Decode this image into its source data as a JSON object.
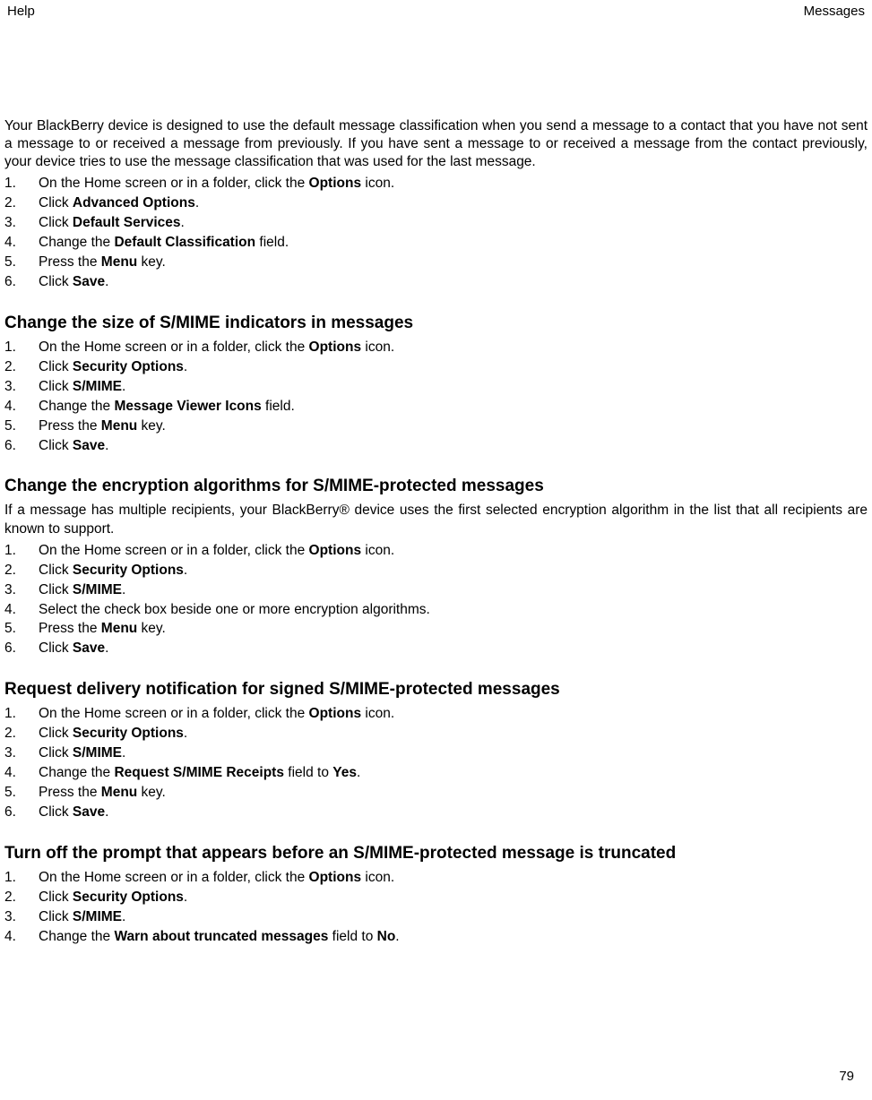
{
  "header": {
    "left": "Help",
    "right": "Messages"
  },
  "pageNumber": "79",
  "intro": "Your BlackBerry device is designed to use the default message classification when you send a message to a contact that you have not sent a message to or received a message from previously. If you have sent a message to or received a message from the contact previously, your device tries to use the message classification that was used for the last message.",
  "sec0": {
    "s1a": "On the Home screen or in a folder, click the ",
    "s1b": "Options",
    "s1c": " icon.",
    "s2a": "Click ",
    "s2b": "Advanced Options",
    "s2c": ".",
    "s3a": "Click ",
    "s3b": "Default Services",
    "s3c": ".",
    "s4a": "Change the ",
    "s4b": "Default Classification",
    "s4c": " field.",
    "s5a": "Press the ",
    "s5b": "Menu",
    "s5c": " key.",
    "s6a": "Click ",
    "s6b": "Save",
    "s6c": "."
  },
  "sec1": {
    "title": "Change the size of S/MIME indicators in messages",
    "s1a": "On the Home screen or in a folder, click the ",
    "s1b": "Options",
    "s1c": " icon.",
    "s2a": "Click ",
    "s2b": "Security Options",
    "s2c": ".",
    "s3a": "Click ",
    "s3b": "S/MIME",
    "s3c": ".",
    "s4a": "Change the ",
    "s4b": "Message Viewer Icons",
    "s4c": " field.",
    "s5a": "Press the ",
    "s5b": "Menu",
    "s5c": " key.",
    "s6a": "Click ",
    "s6b": "Save",
    "s6c": "."
  },
  "sec2": {
    "title": "Change the encryption algorithms for S/MIME-protected messages",
    "intro": "If a message has multiple recipients, your BlackBerry® device uses the first selected encryption algorithm in the list that all recipients are known to support.",
    "s1a": "On the Home screen or in a folder, click the ",
    "s1b": "Options",
    "s1c": " icon.",
    "s2a": "Click ",
    "s2b": "Security Options",
    "s2c": ".",
    "s3a": "Click ",
    "s3b": "S/MIME",
    "s3c": ".",
    "s4a": "Select the check box beside one or more encryption algorithms.",
    "s5a": "Press the ",
    "s5b": "Menu",
    "s5c": " key.",
    "s6a": "Click ",
    "s6b": "Save",
    "s6c": "."
  },
  "sec3": {
    "title": "Request delivery notification for signed S/MIME-protected messages",
    "s1a": "On the Home screen or in a folder, click the ",
    "s1b": "Options",
    "s1c": " icon.",
    "s2a": "Click ",
    "s2b": "Security Options",
    "s2c": ".",
    "s3a": "Click ",
    "s3b": "S/MIME",
    "s3c": ".",
    "s4a": "Change the ",
    "s4b": "Request S/MIME Receipts",
    "s4c": " field to ",
    "s4d": "Yes",
    "s4e": ".",
    "s5a": "Press the ",
    "s5b": "Menu",
    "s5c": " key.",
    "s6a": "Click ",
    "s6b": "Save",
    "s6c": "."
  },
  "sec4": {
    "title": "Turn off the prompt that appears before an S/MIME-protected message is truncated",
    "s1a": "On the Home screen or in a folder, click the ",
    "s1b": "Options",
    "s1c": " icon.",
    "s2a": "Click ",
    "s2b": "Security Options",
    "s2c": ".",
    "s3a": "Click ",
    "s3b": "S/MIME",
    "s3c": ".",
    "s4a": "Change the ",
    "s4b": "Warn about truncated messages",
    "s4c": " field to ",
    "s4d": "No",
    "s4e": "."
  }
}
